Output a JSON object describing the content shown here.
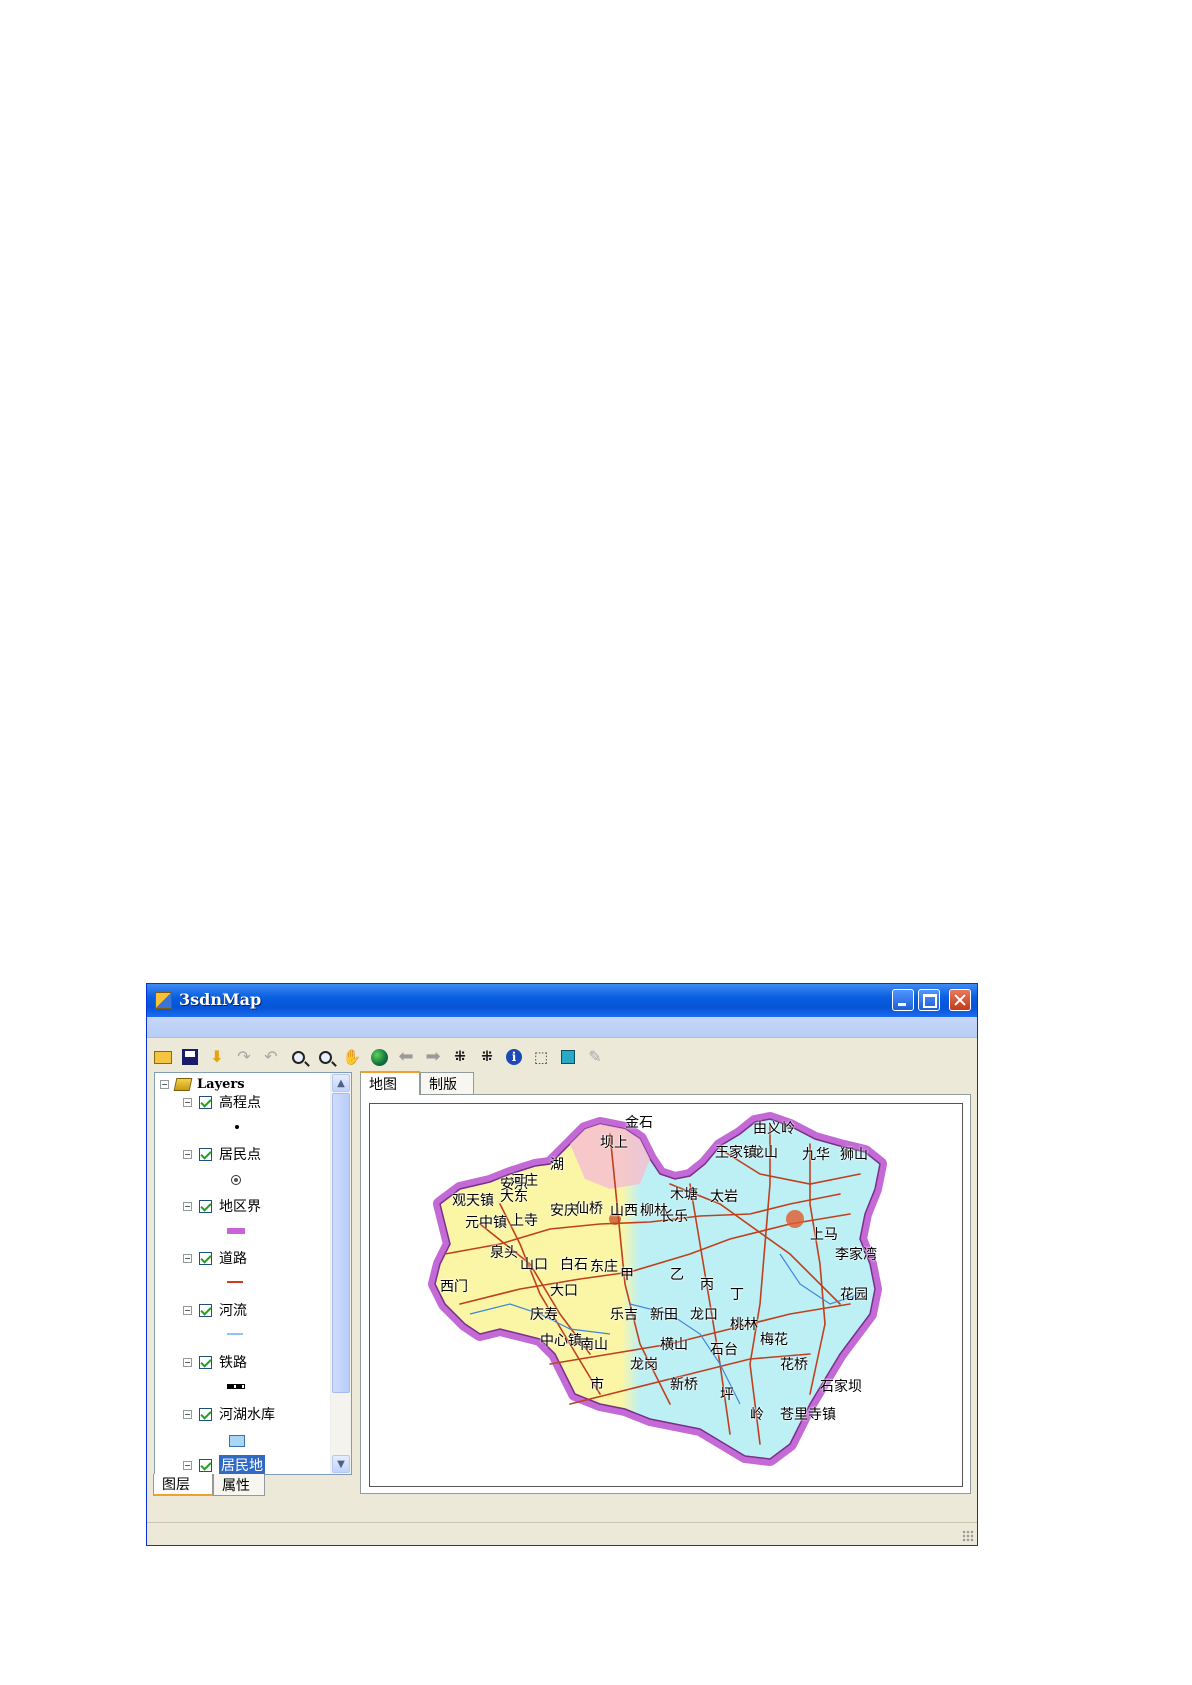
{
  "window": {
    "title": "3sdnMap"
  },
  "toolbar": {
    "icons": [
      "open-icon",
      "save-icon",
      "add-data-icon",
      "redo-icon",
      "undo-icon",
      "zoom-in-icon",
      "zoom-out-icon",
      "pan-icon",
      "full-extent-icon",
      "back-icon",
      "forward-icon",
      "fixed-zoom-in-icon",
      "fixed-zoom-out-icon",
      "identify-icon",
      "select-icon",
      "clear-selection-icon",
      "edit-icon"
    ]
  },
  "toc": {
    "root_label": "Layers",
    "layers": [
      {
        "name": "高程点",
        "checked": true,
        "symbol": "dot"
      },
      {
        "name": "居民点",
        "checked": true,
        "symbol": "town"
      },
      {
        "name": "地区界",
        "checked": true,
        "symbol": "boundary"
      },
      {
        "name": "道路",
        "checked": true,
        "symbol": "road"
      },
      {
        "name": "河流",
        "checked": true,
        "symbol": "river"
      },
      {
        "name": "铁路",
        "checked": true,
        "symbol": "rail"
      },
      {
        "name": "河湖水库",
        "checked": true,
        "symbol": "lake"
      },
      {
        "name": "居民地",
        "checked": true,
        "selected": true
      }
    ]
  },
  "bottom_tabs": {
    "layers": "图层",
    "properties": "属性"
  },
  "view_tabs": {
    "map": "地图",
    "layout": "制版"
  },
  "map": {
    "colors": {
      "boundary": "#c46ad6",
      "west_fill": "#fbf6a6",
      "east_fill": "#bdf0f5",
      "north_fill": "#f4c0cf",
      "road": "#c0401e"
    },
    "labels": [
      "金石",
      "由义岭",
      "坝上",
      "龙山",
      "王家镇",
      "九华",
      "狮山",
      "安乐",
      "大东",
      "河庄",
      "湖",
      "观天镇",
      "元中镇",
      "上寺",
      "仙桥",
      "安庆",
      "山西",
      "柳林",
      "长乐",
      "木塘",
      "太岩",
      "泉头",
      "山口",
      "白石",
      "东庄",
      "西门",
      "大口",
      "甲",
      "乙",
      "丙",
      "丁",
      "上马",
      "李家湾",
      "花园",
      "庆寿",
      "乐吉",
      "新田",
      "龙口",
      "桃林",
      "梅花",
      "花桥",
      "苍里寺镇",
      "石家坝",
      "中心镇",
      "南山",
      "横山",
      "石台",
      "龙岗",
      "新桥",
      "坪",
      "市",
      "岭"
    ]
  }
}
